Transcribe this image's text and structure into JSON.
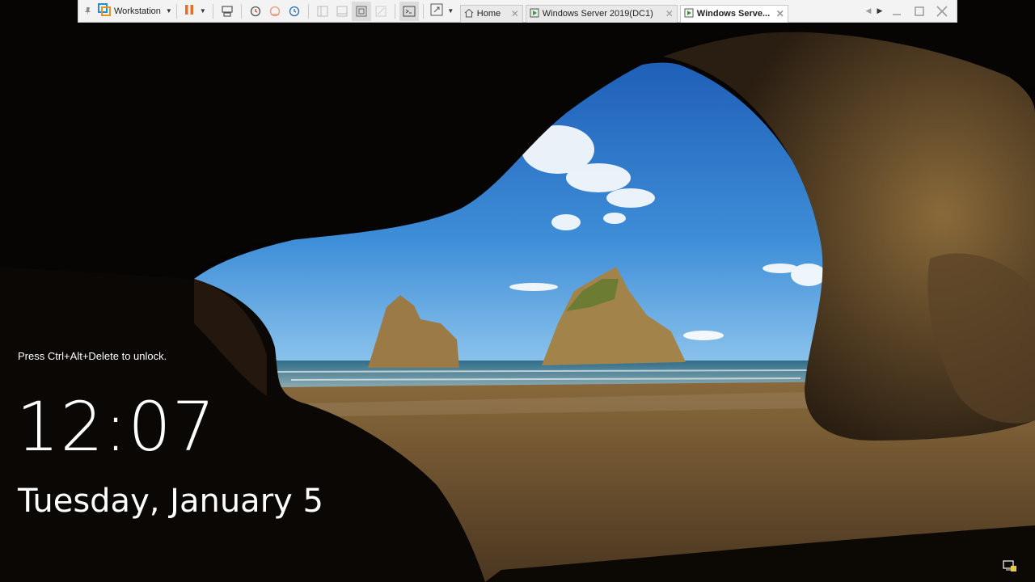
{
  "toolbar": {
    "product_label": "Workstation",
    "tabs": [
      {
        "label": "Home"
      },
      {
        "label": "Windows Server 2019(DC1)"
      },
      {
        "label": "Windows Serve..."
      }
    ]
  },
  "lock_screen": {
    "unlock_hint": "Press Ctrl+Alt+Delete to unlock.",
    "time": "12:07",
    "date": "Tuesday, January 5"
  },
  "colors": {
    "toolbar_bg": "#f3f3f3",
    "pause_orange": "#e0702a",
    "vm_green": "#3a9b3a"
  },
  "icons": [
    "pin-icon",
    "vmware-logo-icon",
    "pause-icon",
    "send-keys-icon",
    "snapshot-icon",
    "revert-snapshot-icon",
    "snapshot-manager-icon",
    "console-icon",
    "fullscreen-icon",
    "home-icon",
    "vm-icon",
    "minimize-icon",
    "maximize-icon",
    "close-icon",
    "network-tray-icon"
  ]
}
